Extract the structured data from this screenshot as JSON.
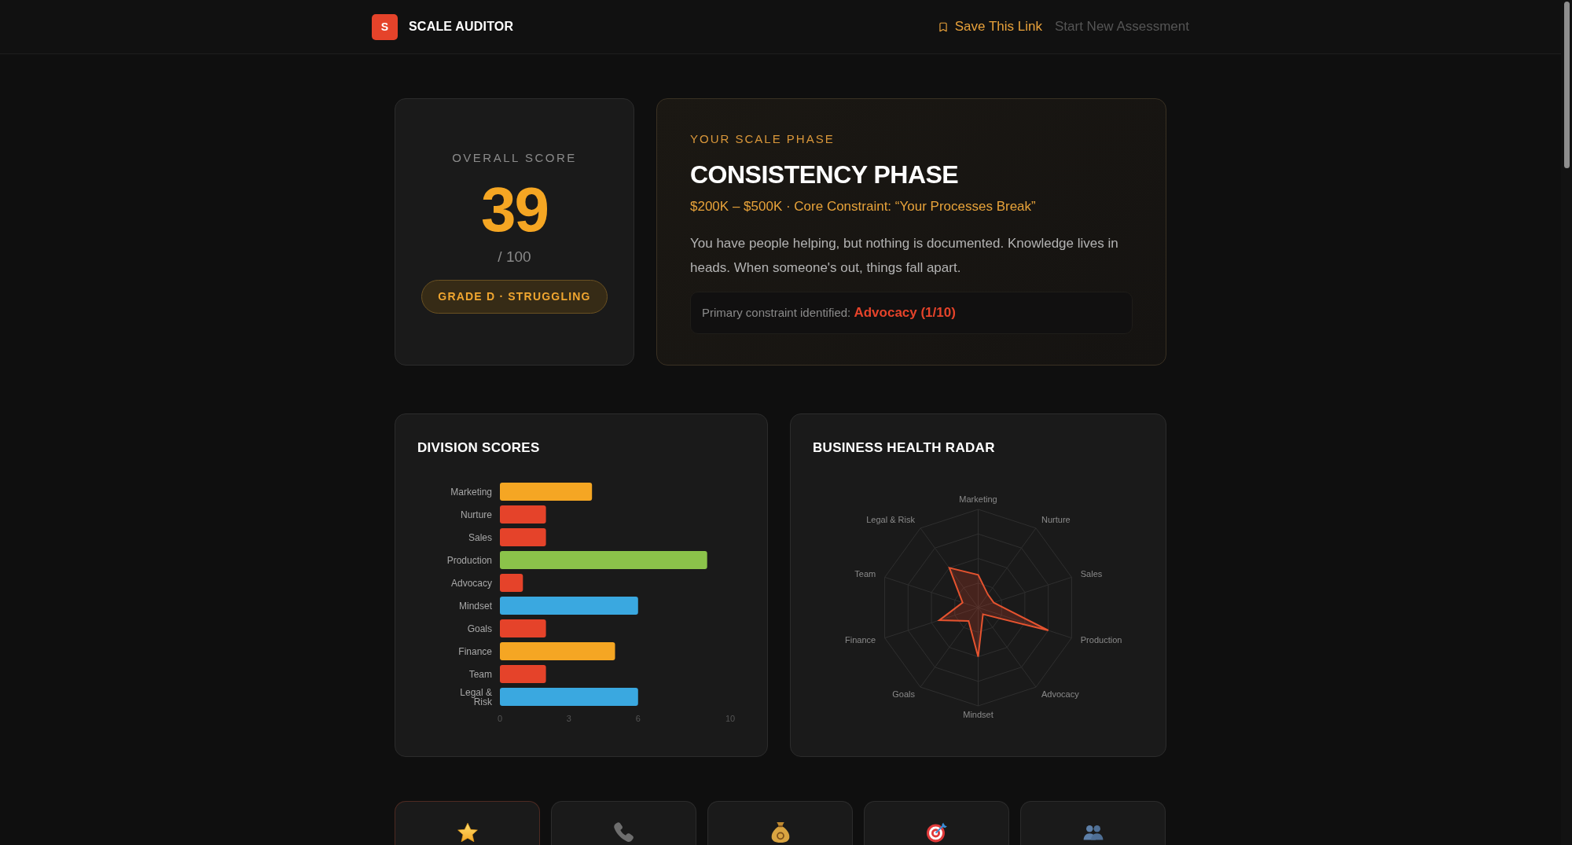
{
  "header": {
    "logo": "S",
    "brand": "SCALE AUDITOR",
    "nav": [
      {
        "label": "Save This Link",
        "kind": "primary"
      },
      {
        "label": "Start New Assessment",
        "kind": "secondary"
      }
    ]
  },
  "score_card": {
    "label": "OVERALL SCORE",
    "score": "39",
    "out_of": "/ 100",
    "grade": "GRADE D · STRUGGLING"
  },
  "phase_card": {
    "eyebrow": "YOUR SCALE PHASE",
    "title": "CONSISTENCY PHASE",
    "subtitle": "$200K – $500K · Core Constraint: “Your Processes Break”",
    "description": "You have people helping, but nothing is documented. Knowledge lives in heads. When someone's out, things fall apart.",
    "constraint": "Primary constraint identified: **Advocacy (1/10)**"
  },
  "division_scores": {
    "title": "DIVISION SCORES",
    "chart_data": {
      "type": "bar",
      "orientation": "horizontal",
      "categories": [
        "Marketing",
        "Nurture",
        "Sales",
        "Production",
        "Advocacy",
        "Mindset",
        "Goals",
        "Finance",
        "Team",
        "Legal & Risk"
      ],
      "values": [
        4,
        2,
        2,
        9,
        1,
        6,
        2,
        5,
        2,
        6
      ],
      "colors": [
        "#f5a623",
        "#e5432a",
        "#e5432a",
        "#8bc34a",
        "#e5432a",
        "#3aa8e0",
        "#e5432a",
        "#f5a623",
        "#e5432a",
        "#3aa8e0"
      ],
      "xlim": [
        0,
        10
      ],
      "xticks": [
        0,
        3,
        6,
        10
      ]
    }
  },
  "health_radar": {
    "title": "BUSINESS HEALTH RADAR",
    "axes": [
      "Marketing",
      "Legal & Risk",
      "Nurture",
      "Team",
      "Sales",
      "Finance",
      "Production",
      "Goals",
      "Advocacy",
      "Mindset"
    ]
  },
  "division_cards": [
    {
      "kind": "star",
      "highlighted": true
    },
    {
      "kind": "phone",
      "highlighted": false
    },
    {
      "kind": "money-bag",
      "highlighted": false
    },
    {
      "kind": "target",
      "highlighted": false
    },
    {
      "kind": "people",
      "highlighted": false
    }
  ]
}
